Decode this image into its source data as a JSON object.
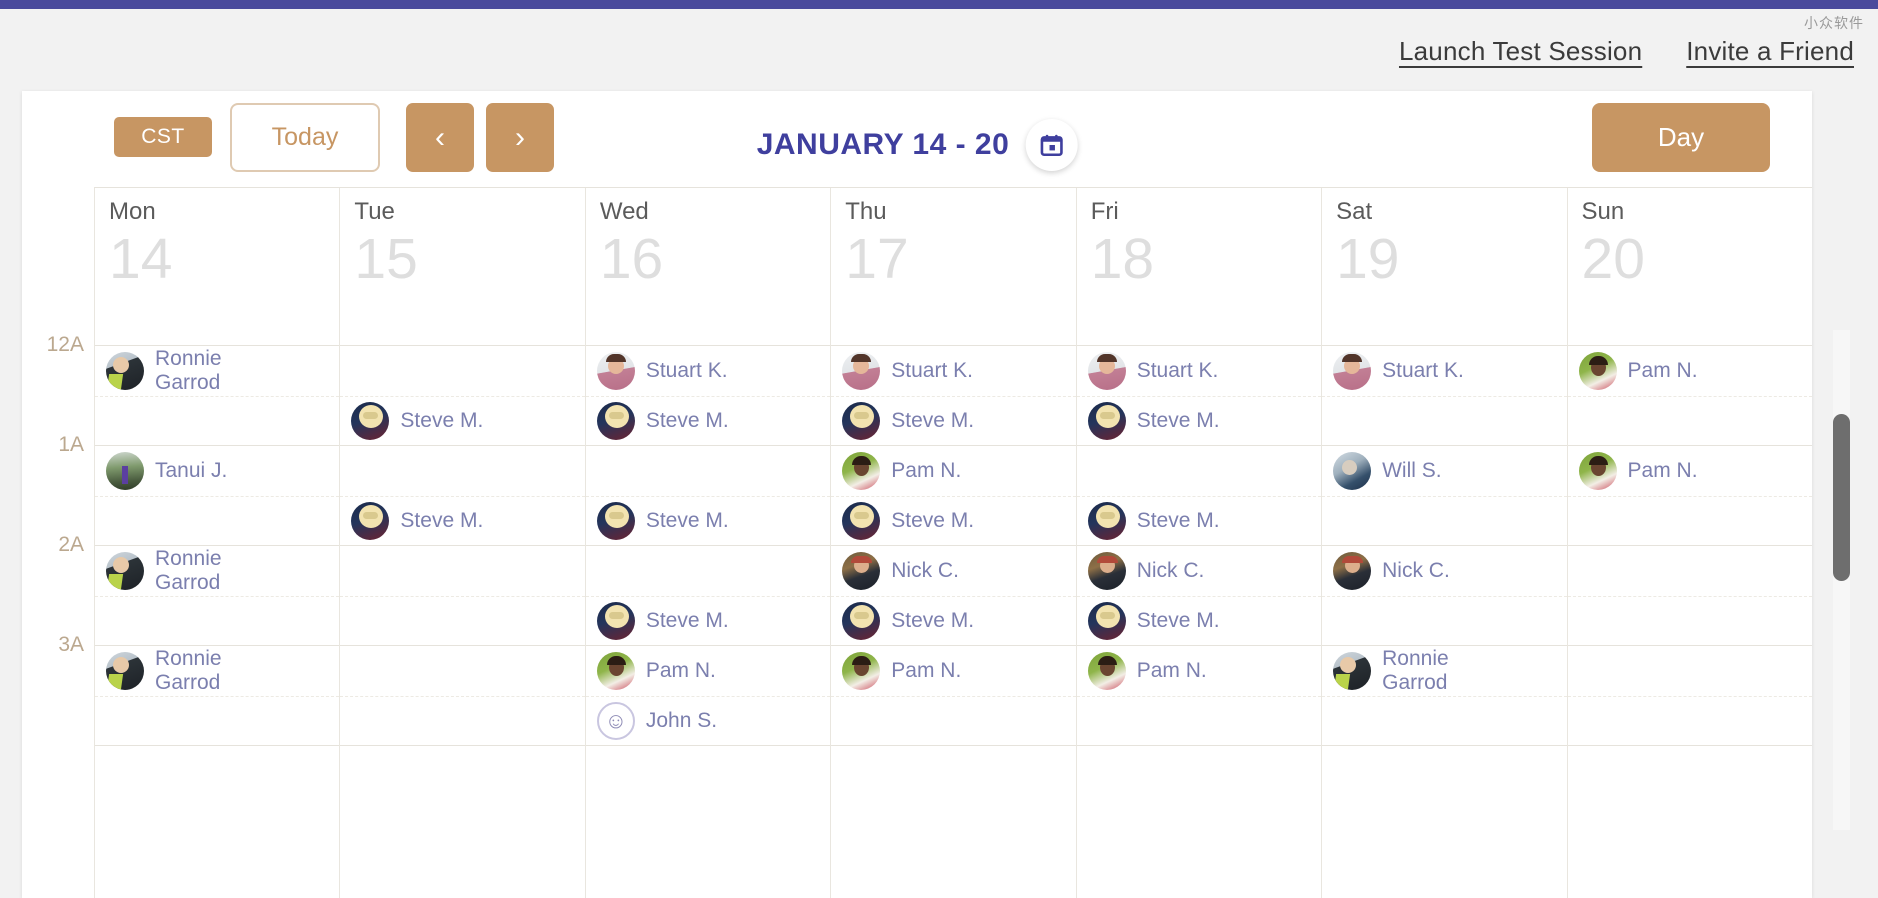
{
  "watermark": "小众软件",
  "header": {
    "links": [
      {
        "label": "Launch Test Session",
        "name": "launch-test-session-link"
      },
      {
        "label": "Invite a Friend",
        "name": "invite-a-friend-link"
      }
    ]
  },
  "toolbar": {
    "timezone": "CST",
    "today_label": "Today",
    "prev_icon": "‹",
    "next_icon": "›",
    "date_range": "JANUARY 14 - 20",
    "calendar_icon": "calendar-icon",
    "view_label": "Day"
  },
  "calendar": {
    "time_labels": [
      "12A",
      "1A",
      "2A",
      "3A"
    ],
    "days": [
      {
        "name": "Mon",
        "num": "14"
      },
      {
        "name": "Tue",
        "num": "15"
      },
      {
        "name": "Wed",
        "num": "16"
      },
      {
        "name": "Thu",
        "num": "17"
      },
      {
        "name": "Fri",
        "num": "18"
      },
      {
        "name": "Sat",
        "num": "19"
      },
      {
        "name": "Sun",
        "num": "20"
      }
    ],
    "columns": [
      {
        "day": "Mon",
        "hours": [
          {
            "top": {
              "label": "Ronnie\nGarrod",
              "avatar": "av-ronnie"
            },
            "bot": null
          },
          {
            "top": {
              "label": "Tanui J.",
              "avatar": "av-tanui"
            },
            "bot": null
          },
          {
            "top": {
              "label": "Ronnie\nGarrod",
              "avatar": "av-ronnie"
            },
            "bot": null
          },
          {
            "top": {
              "label": "Ronnie\nGarrod",
              "avatar": "av-ronnie"
            },
            "bot": null
          }
        ]
      },
      {
        "day": "Tue",
        "hours": [
          {
            "top": null,
            "bot": {
              "label": "Steve M.",
              "avatar": "av-steve"
            }
          },
          {
            "top": null,
            "bot": {
              "label": "Steve M.",
              "avatar": "av-steve"
            }
          },
          {
            "top": null,
            "bot": null
          },
          {
            "top": null,
            "bot": null
          }
        ]
      },
      {
        "day": "Wed",
        "hours": [
          {
            "top": {
              "label": "Stuart K.",
              "avatar": "av-stuart"
            },
            "bot": {
              "label": "Steve M.",
              "avatar": "av-steve"
            }
          },
          {
            "top": null,
            "bot": {
              "label": "Steve M.",
              "avatar": "av-steve"
            }
          },
          {
            "top": null,
            "bot": {
              "label": "Steve M.",
              "avatar": "av-steve"
            }
          },
          {
            "top": {
              "label": "Pam N.",
              "avatar": "av-pam"
            },
            "bot": {
              "label": "John S.",
              "avatar": "av-placeholder"
            }
          }
        ]
      },
      {
        "day": "Thu",
        "hours": [
          {
            "top": {
              "label": "Stuart K.",
              "avatar": "av-stuart"
            },
            "bot": {
              "label": "Steve M.",
              "avatar": "av-steve"
            }
          },
          {
            "top": {
              "label": "Pam N.",
              "avatar": "av-pam"
            },
            "bot": {
              "label": "Steve M.",
              "avatar": "av-steve"
            }
          },
          {
            "top": {
              "label": "Nick C.",
              "avatar": "av-nick"
            },
            "bot": {
              "label": "Steve M.",
              "avatar": "av-steve"
            }
          },
          {
            "top": {
              "label": "Pam N.",
              "avatar": "av-pam"
            },
            "bot": null
          }
        ]
      },
      {
        "day": "Fri",
        "hours": [
          {
            "top": {
              "label": "Stuart K.",
              "avatar": "av-stuart"
            },
            "bot": {
              "label": "Steve M.",
              "avatar": "av-steve"
            }
          },
          {
            "top": null,
            "bot": {
              "label": "Steve M.",
              "avatar": "av-steve"
            }
          },
          {
            "top": {
              "label": "Nick C.",
              "avatar": "av-nick"
            },
            "bot": {
              "label": "Steve M.",
              "avatar": "av-steve"
            }
          },
          {
            "top": {
              "label": "Pam N.",
              "avatar": "av-pam"
            },
            "bot": null
          }
        ]
      },
      {
        "day": "Sat",
        "hours": [
          {
            "top": {
              "label": "Stuart K.",
              "avatar": "av-stuart"
            },
            "bot": null
          },
          {
            "top": {
              "label": "Will S.",
              "avatar": "av-will"
            },
            "bot": null
          },
          {
            "top": {
              "label": "Nick C.",
              "avatar": "av-nick"
            },
            "bot": null
          },
          {
            "top": {
              "label": "Ronnie\nGarrod",
              "avatar": "av-ronnie"
            },
            "bot": null
          }
        ]
      },
      {
        "day": "Sun",
        "hours": [
          {
            "top": {
              "label": "Pam N.",
              "avatar": "av-pam"
            },
            "bot": null
          },
          {
            "top": {
              "label": "Pam N.",
              "avatar": "av-pam"
            },
            "bot": null
          },
          {
            "top": null,
            "bot": null
          },
          {
            "top": null,
            "bot": null
          }
        ]
      }
    ]
  },
  "colors": {
    "accent_tan": "#c79663",
    "topbar_indigo": "#4a4a9c",
    "title_indigo": "#3f3f9e",
    "event_text": "#7b7fae"
  }
}
